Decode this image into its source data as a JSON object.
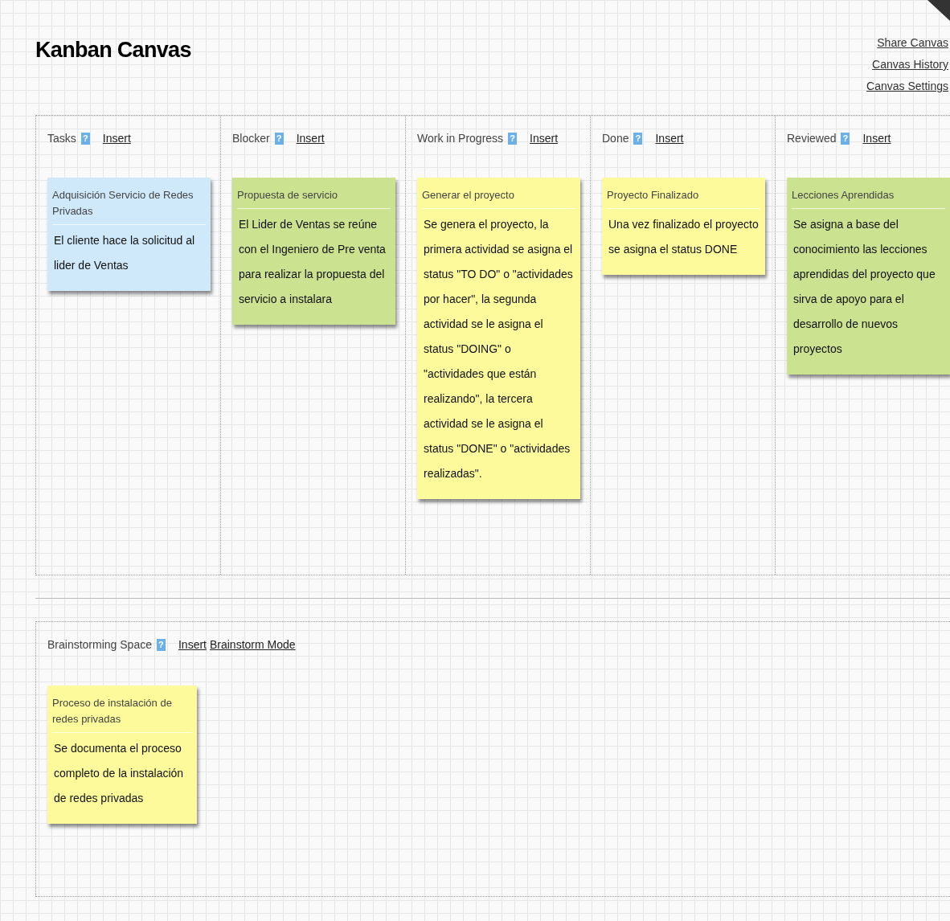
{
  "title": "Kanban Canvas",
  "links": [
    "Share Canvas",
    "Canvas History",
    "Canvas Settings"
  ],
  "columns": [
    {
      "name": "Tasks",
      "help": "?",
      "action": "Insert",
      "cards": [
        {
          "title": "Adquisición Servicio de Redes Privadas",
          "body": "El cliente hace la solicitud al lider de Ventas",
          "color": "#cfe9fb"
        }
      ]
    },
    {
      "name": "Blocker",
      "help": "?",
      "action": "Insert",
      "cards": [
        {
          "title": "Propuesta de servicio",
          "body": "El Lider de Ventas se reúne con el Ingeniero de Pre venta para realizar la propuesta del servicio a instalara",
          "color": "#cbe290"
        }
      ]
    },
    {
      "name": "Work in Progress",
      "help": "?",
      "action": "Insert",
      "cards": [
        {
          "title": "Generar el proyecto",
          "body": "Se genera el proyecto, la primera actividad se asigna el status \"TO DO\" o \"actividades por hacer\", la segunda actividad se le asigna el status \"DOING\" o \"actividades que están realizando\", la tercera actividad se le asigna el status \"DONE\" o \"actividades realizadas\".",
          "color": "#fdfa9b"
        }
      ]
    },
    {
      "name": "Done",
      "help": "?",
      "action": "Insert",
      "cards": [
        {
          "title": "Proyecto Finalizado",
          "body": "Una vez finalizado el proyecto se asigna el status DONE",
          "color": "#fdfa9b"
        }
      ]
    },
    {
      "name": "Reviewed",
      "help": "?",
      "action": "Insert",
      "cards": [
        {
          "title": "Lecciones Aprendidas",
          "body": "Se asigna a base del conocimiento las lecciones aprendidas del proyecto que sirva de apoyo para el desarrollo de nuevos proyectos",
          "color": "#cbe290"
        }
      ]
    }
  ],
  "brainstorm": {
    "name": "Brainstorming Space",
    "help": "?",
    "actions": [
      "Insert",
      "Brainstorm Mode"
    ],
    "cards": [
      {
        "title": "Proceso de instalación de redes privadas",
        "body": "Se documenta el proceso completo de la instalación de redes privadas",
        "color": "#fdfa9b"
      }
    ]
  }
}
